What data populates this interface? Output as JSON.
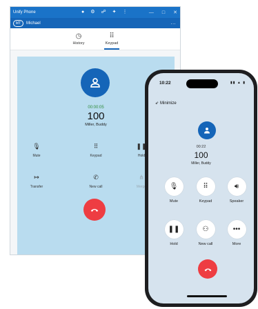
{
  "desktop": {
    "title": "Unify Phone",
    "titlebar_icons": [
      "camera-icon",
      "key-icon",
      "voicemail-icon",
      "puzzle-icon",
      "kebab-menu-icon"
    ],
    "window_controls": [
      "minimize-icon",
      "maximize-icon",
      "close-icon"
    ],
    "user": {
      "initials": "MT",
      "name": "Michael",
      "more": "..."
    },
    "tabs": [
      {
        "id": "history",
        "label": "History",
        "icon": "clock-icon",
        "active": false
      },
      {
        "id": "keypad",
        "label": "Keypad",
        "icon": "dialpad-icon",
        "active": true
      }
    ],
    "call": {
      "timer": "00:00:05",
      "number": "100",
      "name": "Miller, Buddy",
      "controls": [
        {
          "id": "mute",
          "label": "Mute",
          "icon": "mic-off-icon",
          "disabled": false
        },
        {
          "id": "keypad",
          "label": "Keypad",
          "icon": "dialpad-icon",
          "disabled": false
        },
        {
          "id": "hold",
          "label": "Hold",
          "icon": "pause-icon",
          "disabled": false
        },
        {
          "id": "transfer",
          "label": "Transfer",
          "icon": "transfer-icon",
          "disabled": false
        },
        {
          "id": "newcall",
          "label": "New call",
          "icon": "add-call-icon",
          "disabled": false
        },
        {
          "id": "merge",
          "label": "Merge",
          "icon": "merge-icon",
          "disabled": true
        }
      ]
    }
  },
  "phone": {
    "time": "10:22",
    "minimize": "Minimize",
    "call": {
      "timer": "00:22",
      "number": "100",
      "name": "Miller, Buddy"
    },
    "controls": [
      {
        "id": "mute",
        "label": "Mute",
        "icon": "mic-off-icon"
      },
      {
        "id": "keypad",
        "label": "Keypad",
        "icon": "dialpad-icon"
      },
      {
        "id": "speaker",
        "label": "Speaker",
        "icon": "speaker-icon"
      },
      {
        "id": "hold",
        "label": "Hold",
        "icon": "pause-icon"
      },
      {
        "id": "newcall",
        "label": "New call",
        "icon": "add-user-icon"
      },
      {
        "id": "more",
        "label": "More",
        "icon": "more-icon"
      }
    ]
  },
  "colors": {
    "brand_blue": "#1565b8",
    "titlebar_blue": "#1a73c8",
    "call_panel": "#b9dcef",
    "hangup_red": "#ee3d42",
    "timer_green": "#2e8b3a"
  }
}
